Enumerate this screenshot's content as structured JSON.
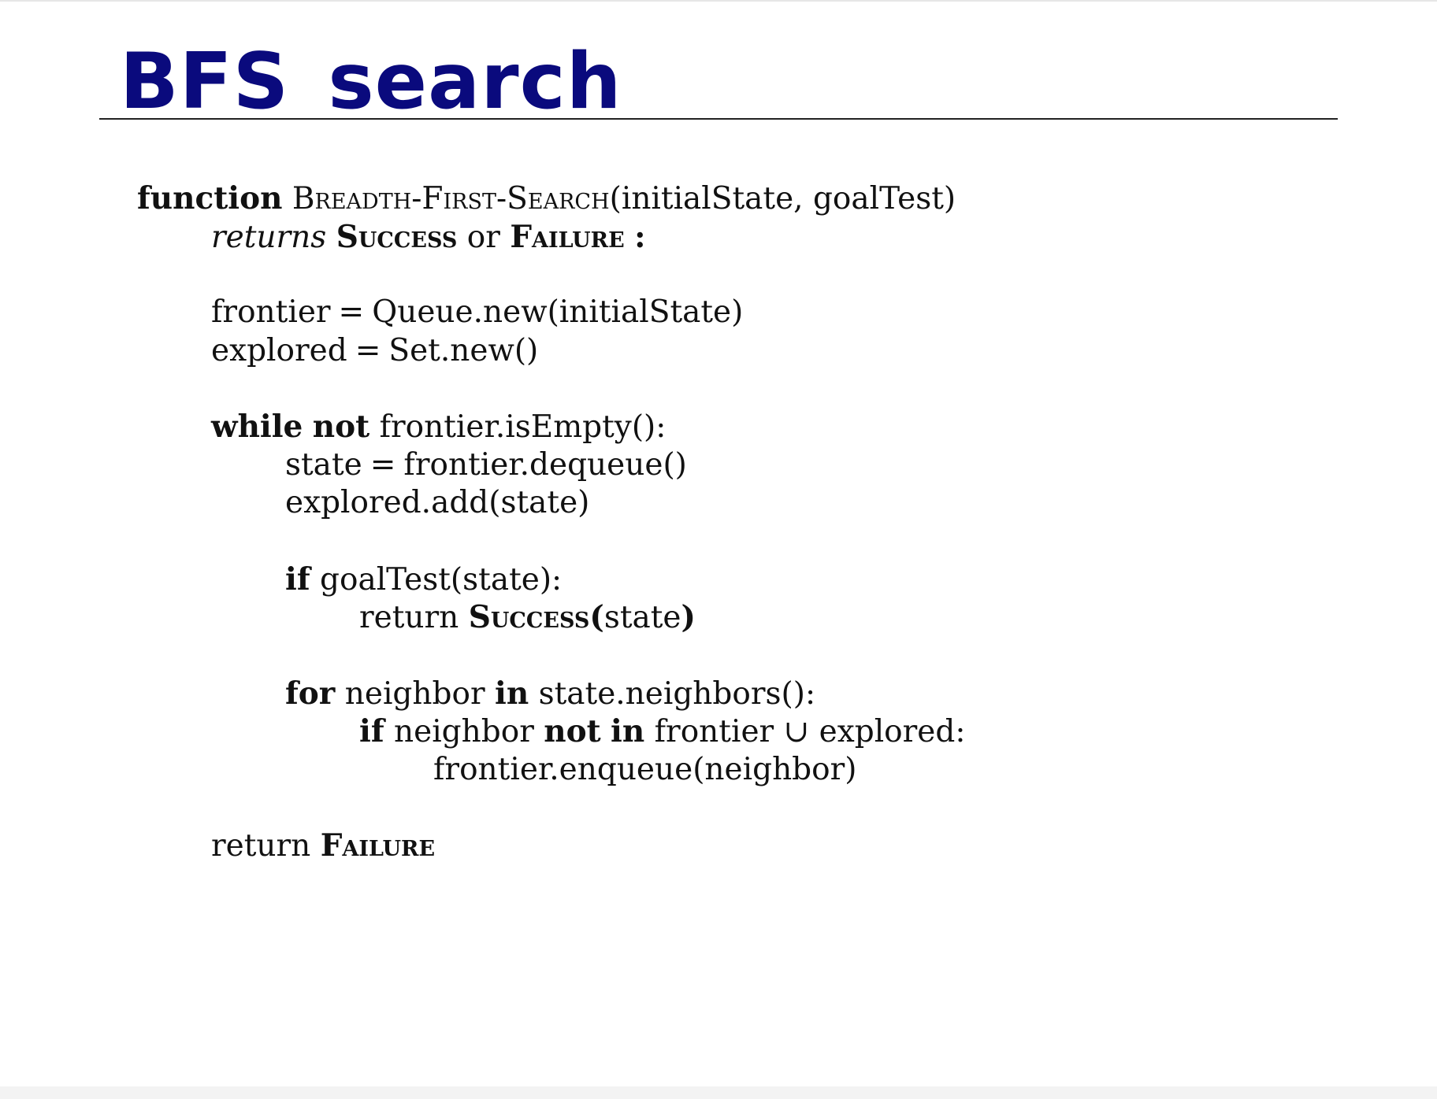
{
  "slide": {
    "title": "BFS search"
  },
  "algorithm": {
    "l1": {
      "kw_function": "function",
      "name": "Breadth-First-Search",
      "params": "(initialState, goalTest)"
    },
    "l2": {
      "returns": "returns",
      "success": "Success",
      "or": "or",
      "failure": "Failure",
      "colon": ":"
    },
    "l3": {
      "lhs": "frontier",
      "eq": "=",
      "rhs": "Queue.new(initialState)"
    },
    "l4": {
      "lhs": "explored",
      "eq": "=",
      "rhs": "Set.new()"
    },
    "l5": {
      "kw_while": "while",
      "kw_not": "not",
      "expr": "frontier.isEmpty():"
    },
    "l6": {
      "lhs": "state",
      "eq": "=",
      "rhs": "frontier.dequeue()"
    },
    "l7": {
      "text": "explored.add(state)"
    },
    "l8": {
      "kw_if": "if",
      "expr": "goalTest(state):"
    },
    "l9": {
      "return": "return",
      "success": "Success(",
      "arg": "state",
      "close": ")"
    },
    "l10": {
      "kw_for": "for",
      "var": "neighbor",
      "kw_in": "in",
      "expr": "state.neighbors():"
    },
    "l11": {
      "kw_if": "if",
      "var": "neighbor",
      "kw_not": "not",
      "kw_in": "in",
      "frontier": "frontier",
      "union": "∪",
      "explored": "explored:"
    },
    "l12": {
      "text": "frontier.enqueue(neighbor)"
    },
    "l13": {
      "return": "return",
      "failure": "Failure"
    }
  }
}
